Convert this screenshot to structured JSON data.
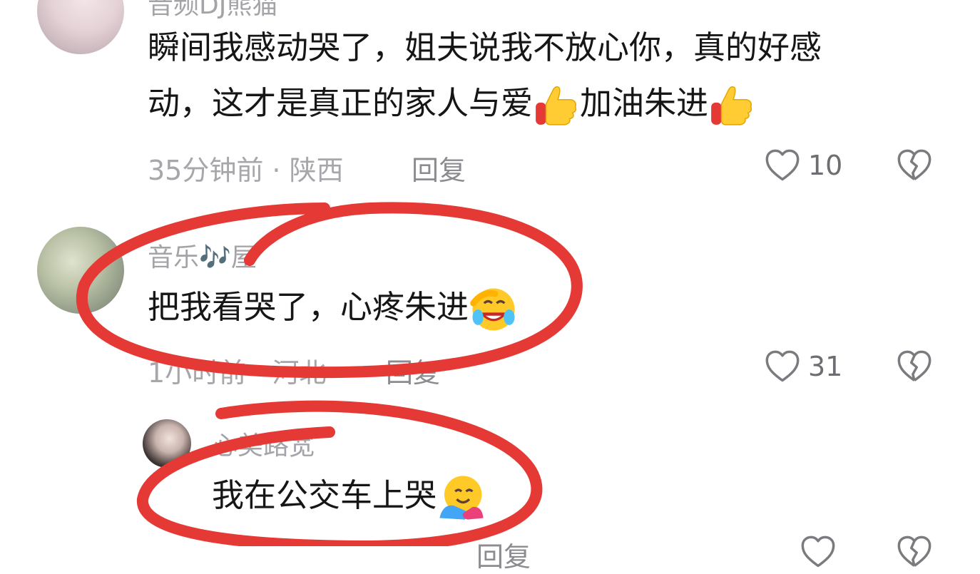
{
  "comments": [
    {
      "username": "音频DJ熊猫",
      "text_line1": "瞬间我感动哭了，姐夫说我不放心你，真的好感",
      "text_line2a": "动，这才是真正的家人与爱",
      "text_line2b": "加油朱进",
      "time_location": "35分钟前 · 陕西",
      "reply_label": "回复",
      "likes": "10"
    },
    {
      "username": "音乐🎶屋",
      "text": "把我看哭了，心疼朱进",
      "time_location": "1小时前 · 河北",
      "reply_label": "回复",
      "likes": "31"
    },
    {
      "username": "心美路宽",
      "text": "我在公交车上哭",
      "reply_label": "回复"
    }
  ],
  "icons": {
    "like": "heart-outline-icon",
    "dislike": "broken-heart-icon",
    "thumbs": "thumbs-up-icon",
    "cry": "rolling-laughing-icon",
    "hug": "hugging-face-icon"
  },
  "colors": {
    "annotation": "#e53935",
    "meta": "#a6a6ab",
    "text": "#161617"
  }
}
